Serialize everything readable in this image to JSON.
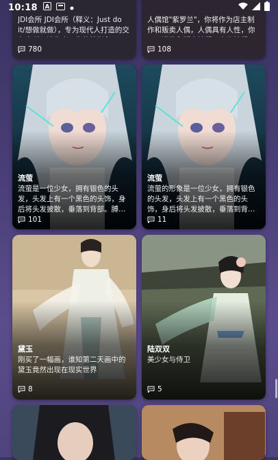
{
  "status_bar": {
    "time": "10:18"
  },
  "cards": [
    {
      "title": "",
      "desc": "JDI会所 JDI会所（释义：Just do it/想做就做），专为现代人打造的交友会所。请先表面你的性别和…",
      "count": "780"
    },
    {
      "title": "",
      "desc": "人偶馆\"紫罗兰\"，你将作为店主制作和贩卖人偶，人偶具有人性，你可以调教和贩卖她们，也许她们…",
      "count": "108"
    },
    {
      "title": "流萤",
      "desc": "流萤是一位少女，拥有银色的头发，头发上有一个黑色的头饰，身后将头发披散，垂落到背部。膊…",
      "count": "101"
    },
    {
      "title": "流萤",
      "desc": "流萤的形象是一位少女，拥有银色的头发，头发上有一个黑色的头饰，身后将头发披散，垂落到背部。",
      "count": "11"
    },
    {
      "title": "黛玉",
      "desc": "刚买了一幅画，谁知第二天画中的黛玉竟然出现在现实世界",
      "count": "8"
    },
    {
      "title": "陆双双",
      "desc": "美少女与侍卫",
      "count": "5"
    }
  ]
}
